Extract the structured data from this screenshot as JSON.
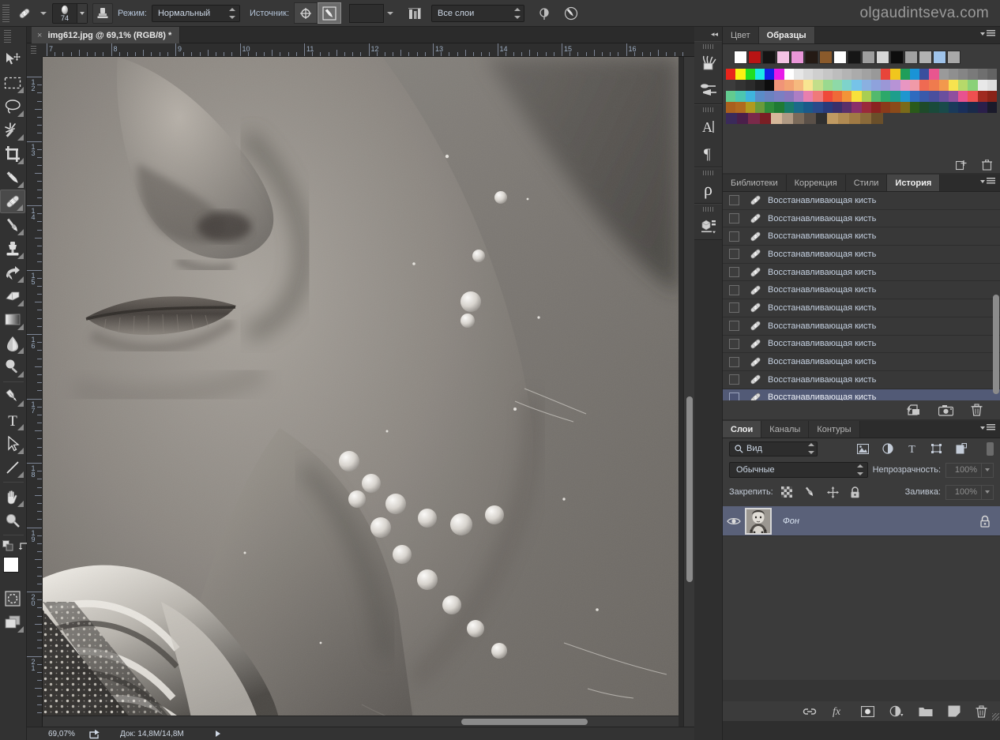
{
  "app": {
    "watermark": "olgaudintseva.com"
  },
  "options_bar": {
    "tool_icon": "healing-brush-icon",
    "brush_size": "74",
    "mode_label": "Режим:",
    "mode_value": "Нормальный",
    "source_label": "Источник:",
    "source_options": [
      "source-sampled-icon",
      "source-pattern-icon"
    ],
    "source_selected": "source-pattern-icon",
    "pattern_swatch": "",
    "alignment_icon": "alignment-icon",
    "sample_value": "Все слои",
    "ignore_adjustment_icon": "ignore-adjustment-layers-icon",
    "pressure_icon": "pressure-for-size-icon"
  },
  "document_tab": {
    "close_glyph": "×",
    "title": "img612.jpg @ 69,1% (RGB/8) *"
  },
  "toolbar": {
    "tools": [
      {
        "name": "move-tool",
        "icon": "move-icon",
        "selected": false,
        "has_flyout": false
      },
      {
        "name": "rectangular-select-tool",
        "icon": "marquee-icon",
        "selected": false,
        "has_flyout": true
      },
      {
        "name": "lasso-tool",
        "icon": "lasso-icon",
        "selected": false,
        "has_flyout": true
      },
      {
        "name": "magic-wand-tool",
        "icon": "magic-wand-icon",
        "selected": false,
        "has_flyout": true
      },
      {
        "name": "crop-tool",
        "icon": "crop-icon",
        "selected": false,
        "has_flyout": true
      },
      {
        "name": "eyedropper-tool",
        "icon": "eyedropper-icon",
        "selected": false,
        "has_flyout": true
      },
      {
        "name": "healing-brush-tool",
        "icon": "healing-brush-icon",
        "selected": true,
        "has_flyout": true
      },
      {
        "name": "brush-tool",
        "icon": "brush-icon",
        "selected": false,
        "has_flyout": true
      },
      {
        "name": "clone-stamp-tool",
        "icon": "stamp-icon",
        "selected": false,
        "has_flyout": true
      },
      {
        "name": "history-brush-tool",
        "icon": "history-brush-icon",
        "selected": false,
        "has_flyout": true
      },
      {
        "name": "eraser-tool",
        "icon": "eraser-icon",
        "selected": false,
        "has_flyout": true
      },
      {
        "name": "gradient-tool",
        "icon": "gradient-icon",
        "selected": false,
        "has_flyout": true
      },
      {
        "name": "blur-tool",
        "icon": "blur-drop-icon",
        "selected": false,
        "has_flyout": true
      },
      {
        "name": "dodge-tool",
        "icon": "dodge-icon",
        "selected": false,
        "has_flyout": true
      },
      {
        "name": "pen-tool",
        "icon": "pen-icon",
        "selected": false,
        "has_flyout": true
      },
      {
        "name": "type-tool",
        "icon": "type-t-icon",
        "selected": false,
        "has_flyout": true
      },
      {
        "name": "path-selection-tool",
        "icon": "path-arrow-icon",
        "selected": false,
        "has_flyout": true
      },
      {
        "name": "line-tool",
        "icon": "line-icon",
        "selected": false,
        "has_flyout": true
      },
      {
        "name": "hand-tool",
        "icon": "hand-icon",
        "selected": false,
        "has_flyout": true
      },
      {
        "name": "zoom-tool",
        "icon": "magnifier-icon",
        "selected": false,
        "has_flyout": false
      }
    ],
    "default_colors_icon": "default-colors-icon",
    "swap_colors_icon": "swap-colors-icon",
    "foreground_color": "#ffffff",
    "background_color": "#f3a3cf",
    "quick_mask_icon": "quick-mask-icon",
    "screen_mode_icon": "screen-mode-icon"
  },
  "canvas": {
    "ruler_h_labels": [
      "7",
      "8",
      "9",
      "10",
      "11",
      "12",
      "13",
      "14",
      "15",
      "16"
    ],
    "ruler_v_labels": [
      "12",
      "13",
      "14",
      "15",
      "16",
      "17",
      "18",
      "19",
      "20",
      "21"
    ],
    "image_description": "black-and-white vintage portrait closeup"
  },
  "statusbar": {
    "zoom": "69,07%",
    "share_icon": "share-icon",
    "doc_info": "Док: 14,8M/14,8M",
    "expand_icon": "expand-arrow-icon"
  },
  "icon_dock": {
    "collapse_icon": "collapse-panels-icon",
    "groups": [
      {
        "icons": [
          "brushes-icon",
          "brush-settings-icon"
        ]
      },
      {
        "icons": [
          "character-icon",
          "paragraph-icon"
        ]
      },
      {
        "icons": [
          "glyphs-icon"
        ]
      },
      {
        "icons": [
          "3d-icon"
        ]
      }
    ]
  },
  "swatches_panel": {
    "tabs": [
      {
        "label": "Цвет",
        "active": false
      },
      {
        "label": "Образцы",
        "active": true
      }
    ],
    "menu_icon": "panel-menu-icon",
    "top_row": [
      "#ffffff",
      "#b81414",
      "#141414",
      "#f3c2e4",
      "#ea96d8",
      "#241a14",
      "#8a5a2b",
      "#ffffff",
      "#161616",
      "#9e9e9e",
      "#d6d6d6",
      "#0d0d0d",
      "#a1a1a1",
      "#b2b2b2",
      "#9fc3ea",
      "#a8a8a8"
    ],
    "grid_rows": [
      [
        "#e8241b",
        "#f9f113",
        "#21de21",
        "#1de8e8",
        "#1320e8",
        "#e81ae8",
        "#ffffff",
        "#e6e6e6",
        "#d9d9d9",
        "#cfcfcf",
        "#c6c6c6",
        "#bdbdbd",
        "#b4b4b4",
        "#ababab",
        "#a2a2a2",
        "#999999",
        "#e8453a",
        "#f0c61e",
        "#1f9e5a",
        "#1a93d6",
        "#3a4f9e",
        "#e8568f",
        "#9a9a9a",
        "#8f8f8f",
        "#858585",
        "#7a7a7a",
        "#6f6f6f",
        "#636363"
      ],
      [
        "#3c3c3c",
        "#333333",
        "#2b2b2b",
        "#1f1f1f",
        "#0d0d0d",
        "#f09478",
        "#f2a273",
        "#f6b97e",
        "#f8e591",
        "#c3de8a",
        "#9ad98f",
        "#8ed9a8",
        "#7ed3cb",
        "#76c3e8",
        "#8ab0e0",
        "#8ea2dc",
        "#9b97d6",
        "#b793d6",
        "#e896c2",
        "#f09aa8",
        "#ef6a52",
        "#ef7b4e",
        "#f2994d",
        "#f7e34f",
        "#b6d96a",
        "#8ad178",
        "#e8e8e8",
        "#dedede"
      ],
      [
        "#62cb8f",
        "#4cc6b0",
        "#3fb4dd",
        "#5a8cc8",
        "#6a82c0",
        "#7b7fc2",
        "#8a77bd",
        "#ad7ec4",
        "#e87fae",
        "#f07a7a",
        "#ef4a3a",
        "#ef6a38",
        "#f29438",
        "#f8e13a",
        "#a8ce52",
        "#52b96d",
        "#2da86a",
        "#1e9e8c",
        "#1f96cf",
        "#2f6bbf",
        "#3a5aab",
        "#4a4f9e",
        "#6a4f9e",
        "#8f4f9e",
        "#e8528f",
        "#ef5050",
        "#a02a20",
        "#8a2318"
      ],
      [
        "#a9601e",
        "#b06a1f",
        "#b09a1f",
        "#6a9a3a",
        "#2f8a3a",
        "#1f7a34",
        "#1a7a6a",
        "#1a6a8a",
        "#1a5a8a",
        "#2a4a8a",
        "#2a3a7a",
        "#3a2f6a",
        "#5a2f6a",
        "#8a2f6a",
        "#9a2a3a",
        "#8a2320",
        "#8a3a1a",
        "#8a4a1a",
        "#7a6a1a",
        "#2a5a1a",
        "#1f4a2a",
        "#1a4a3a",
        "#1a4a4a",
        "#1a3a5a",
        "#1a2f5a",
        "#1a2a4a",
        "#2a1f4a",
        "#1a1a2a"
      ],
      [
        "#3a2a5a",
        "#4a1f4a",
        "#7a2a4a",
        "#7a1f24",
        "#d6b89a",
        "#b09a84",
        "#7a6a5a",
        "#5a5048",
        "#2f2f2f",
        "#c09a62",
        "#b08a52",
        "#a07a44",
        "#8a6a3a",
        "#6a4f2a"
      ]
    ],
    "footer_icons": [
      "new-swatch-icon",
      "delete-swatch-icon"
    ]
  },
  "history_panel": {
    "tabs": [
      {
        "label": "Библиотеки",
        "active": false
      },
      {
        "label": "Коррекция",
        "active": false
      },
      {
        "label": "Стили",
        "active": false
      },
      {
        "label": "История",
        "active": true
      }
    ],
    "menu_icon": "panel-menu-icon",
    "items": [
      {
        "label": "Восстанавливающая кисть",
        "selected": false
      },
      {
        "label": "Восстанавливающая кисть",
        "selected": false
      },
      {
        "label": "Восстанавливающая кисть",
        "selected": false
      },
      {
        "label": "Восстанавливающая кисть",
        "selected": false
      },
      {
        "label": "Восстанавливающая кисть",
        "selected": false
      },
      {
        "label": "Восстанавливающая кисть",
        "selected": false
      },
      {
        "label": "Восстанавливающая кисть",
        "selected": false
      },
      {
        "label": "Восстанавливающая кисть",
        "selected": false
      },
      {
        "label": "Восстанавливающая кисть",
        "selected": false
      },
      {
        "label": "Восстанавливающая кисть",
        "selected": false
      },
      {
        "label": "Восстанавливающая кисть",
        "selected": false
      },
      {
        "label": "Восстанавливающая кисть",
        "selected": true
      }
    ],
    "footer_icons": [
      "create-document-from-state-icon",
      "create-snapshot-icon",
      "delete-state-icon"
    ]
  },
  "layers_panel": {
    "tabs": [
      {
        "label": "Слои",
        "active": true
      },
      {
        "label": "Каналы",
        "active": false
      },
      {
        "label": "Контуры",
        "active": false
      }
    ],
    "menu_icon": "panel-menu-icon",
    "filter_value": "Вид",
    "filter_search_icon": "search-icon",
    "filter_type_icons": [
      "filter-pixel-icon",
      "filter-adjustment-icon",
      "filter-type-icon",
      "filter-shape-icon",
      "filter-smart-object-icon"
    ],
    "blend_mode": "Обычные",
    "opacity_label": "Непрозрачность:",
    "opacity_value": "100%",
    "lock_label": "Закрепить:",
    "lock_icons": [
      "lock-transparency-icon",
      "lock-image-icon",
      "lock-position-icon",
      "lock-all-icon"
    ],
    "fill_label": "Заливка:",
    "fill_value": "100%",
    "layers": [
      {
        "name": "Фон",
        "visible": true,
        "locked": true,
        "selected": true,
        "thumbnail": "portrait-thumbnail"
      }
    ],
    "footer_icons": [
      "link-layers-icon",
      "fx-icon",
      "add-mask-icon",
      "adjustment-layer-icon",
      "new-group-icon",
      "new-layer-icon",
      "delete-layer-icon"
    ]
  }
}
